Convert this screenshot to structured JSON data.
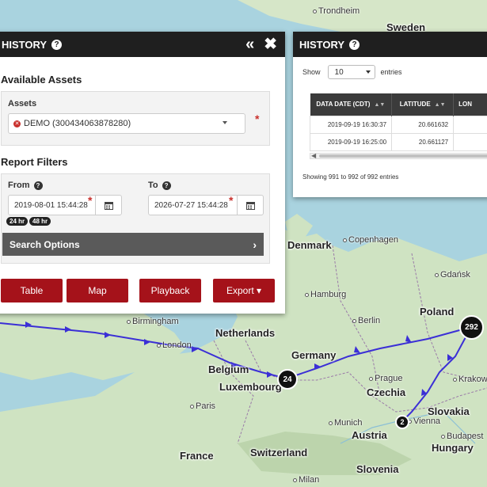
{
  "left_panel": {
    "title": "HISTORY",
    "help_icon": "?",
    "collapse_icon": "«",
    "close_icon": "✖",
    "available_assets": "Available Assets",
    "assets_label": "Assets",
    "asset_selected": "DEMO (300434063878280)",
    "report_filters": "Report Filters",
    "from_label": "From",
    "from_value": "2019-08-01 15:44:28",
    "to_label": "To",
    "to_value": "2026-07-27 15:44:28",
    "quick_24": "24 hr",
    "quick_48": "48 hr",
    "search_options": "Search Options",
    "required_mark": "*",
    "buttons": {
      "table": "Table",
      "map": "Map",
      "playback": "Playback",
      "export": "Export ▾"
    }
  },
  "right_panel": {
    "title": "HISTORY",
    "help_icon": "?",
    "show_label": "Show",
    "show_value": "10",
    "entries_label": "entries",
    "columns": [
      "DATA DATE (CDT)",
      "LATITUDE",
      "LON"
    ],
    "rows": [
      [
        "2019-09-19 16:30:37",
        "20.661632",
        ""
      ],
      [
        "2019-09-19 16:25:00",
        "20.661127",
        ""
      ]
    ],
    "showing_text": "Showing 991 to 992 of 992 entries"
  },
  "map": {
    "cities": {
      "trondheim": "Trondheim",
      "copenhagen": "Copenhagen",
      "gdansk": "Gdańsk",
      "hamburg": "Hamburg",
      "berlin": "Berlin",
      "birmingham": "Birmingham",
      "london": "London",
      "prague": "Prague",
      "krakow": "Krakow",
      "paris": "Paris",
      "munich": "Munich",
      "vienna": "Vienna",
      "budapest": "Budapest",
      "milan": "Milan"
    },
    "countries": {
      "sweden": "Sweden",
      "denmark": "Denmark",
      "poland": "Poland",
      "netherlands": "Netherlands",
      "germany": "Germany",
      "belgium": "Belgium",
      "luxembourg": "Luxembourg",
      "czechia": "Czechia",
      "slovakia": "Slovakia",
      "austria": "Austria",
      "hungary": "Hungary",
      "france": "France",
      "switzerland": "Switzerland",
      "slovenia": "Slovenia"
    },
    "clusters": {
      "c292": "292",
      "c24": "24",
      "c2": "2"
    },
    "track_color": "#3b2fd6",
    "water_color": "#a9d3df",
    "land_color": "#cfe3c2"
  }
}
